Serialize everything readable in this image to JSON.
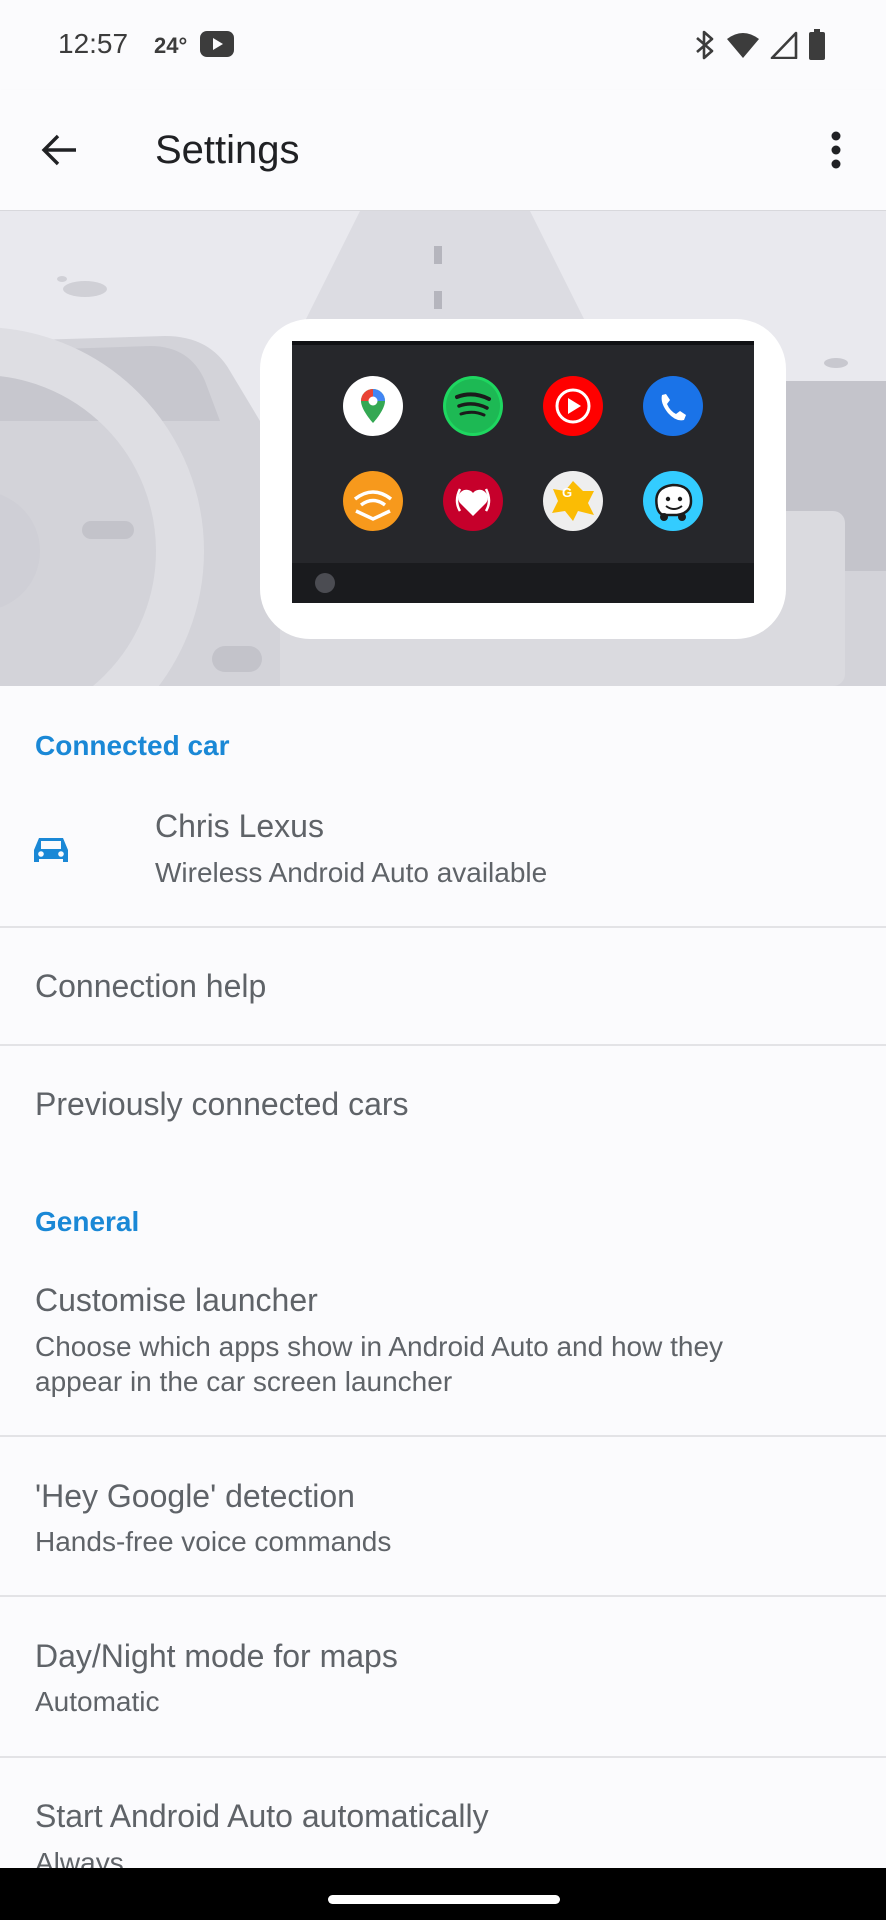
{
  "status_bar": {
    "time": "12:57",
    "temperature": "24°"
  },
  "app_bar": {
    "title": "Settings"
  },
  "hero": {
    "apps": [
      "Maps",
      "Spotify",
      "YouTube Music",
      "Phone",
      "Audible",
      "iHeartRadio",
      "Google News",
      "Waze"
    ]
  },
  "connected_car": {
    "header": "Connected car",
    "car_name": "Chris Lexus",
    "car_status": "Wireless Android Auto available",
    "connection_help": "Connection help",
    "previously_connected": "Previously connected cars"
  },
  "general": {
    "header": "General",
    "customise_title": "Customise launcher",
    "customise_sub_line1": "Choose which apps show in Android Auto and how they",
    "customise_sub_line2": "appear in the car screen launcher",
    "hey_google_title": "'Hey Google' detection",
    "hey_google_sub": "Hands-free voice commands",
    "daynight_title": "Day/Night mode for maps",
    "daynight_sub": "Automatic",
    "start_auto_title": "Start Android Auto automatically",
    "start_auto_sub": "Always"
  },
  "colors": {
    "accent": "#1a88d6",
    "background": "#fbfbfd"
  }
}
